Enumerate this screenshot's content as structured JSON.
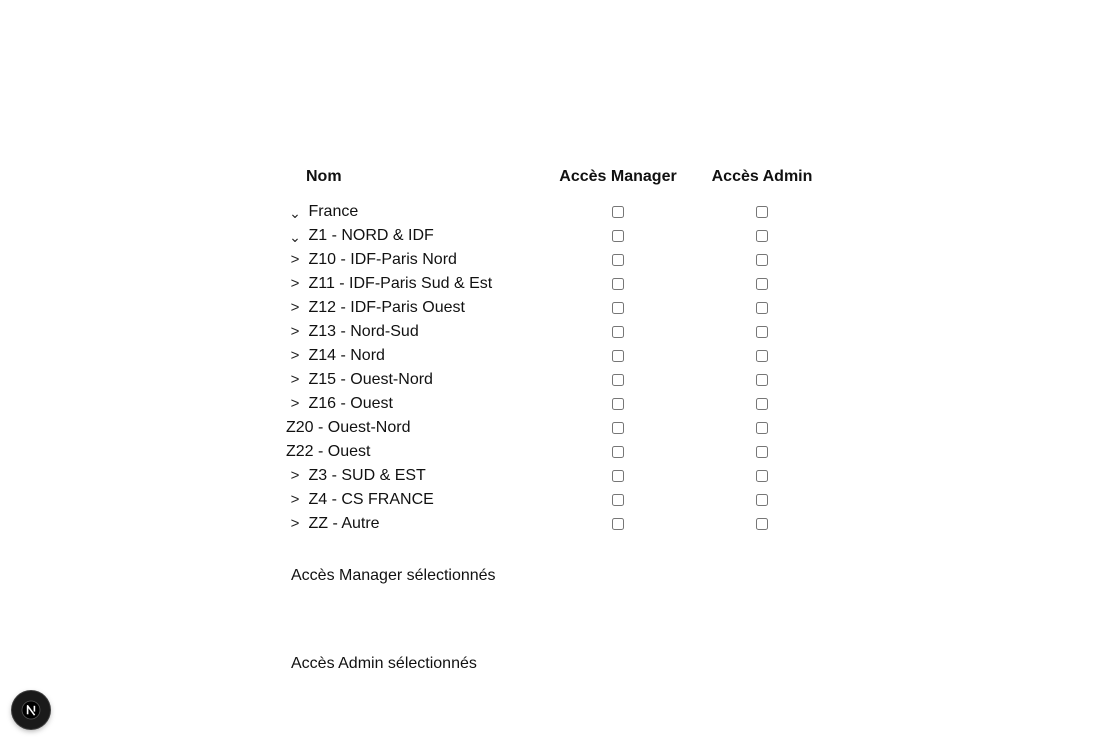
{
  "table": {
    "headers": {
      "name": "Nom",
      "manager": "Accès Manager",
      "admin": "Accès Admin"
    },
    "rows": [
      {
        "label": "France",
        "toggle": "⌄",
        "manager_checked": false,
        "admin_checked": false
      },
      {
        "label": "Z1 - NORD & IDF",
        "toggle": "⌄",
        "manager_checked": false,
        "admin_checked": false
      },
      {
        "label": "Z10 - IDF-Paris Nord",
        "toggle": ">",
        "manager_checked": false,
        "admin_checked": false
      },
      {
        "label": "Z11 - IDF-Paris Sud & Est",
        "toggle": ">",
        "manager_checked": false,
        "admin_checked": false
      },
      {
        "label": "Z12 - IDF-Paris Ouest",
        "toggle": ">",
        "manager_checked": false,
        "admin_checked": false
      },
      {
        "label": "Z13 - Nord-Sud",
        "toggle": ">",
        "manager_checked": false,
        "admin_checked": false
      },
      {
        "label": "Z14 - Nord",
        "toggle": ">",
        "manager_checked": false,
        "admin_checked": false
      },
      {
        "label": "Z15 - Ouest-Nord",
        "toggle": ">",
        "manager_checked": false,
        "admin_checked": false
      },
      {
        "label": "Z16 - Ouest",
        "toggle": ">",
        "manager_checked": false,
        "admin_checked": false
      },
      {
        "label": "Z20 - Ouest-Nord",
        "toggle": "",
        "manager_checked": false,
        "admin_checked": false
      },
      {
        "label": "Z22 - Ouest",
        "toggle": "",
        "manager_checked": false,
        "admin_checked": false
      },
      {
        "label": "Z3 - SUD & EST",
        "toggle": ">",
        "manager_checked": false,
        "admin_checked": false
      },
      {
        "label": "Z4 - CS FRANCE",
        "toggle": ">",
        "manager_checked": false,
        "admin_checked": false
      },
      {
        "label": "ZZ - Autre",
        "toggle": ">",
        "manager_checked": false,
        "admin_checked": false
      }
    ]
  },
  "selected": {
    "manager_label": "Accès Manager sélectionnés",
    "admin_label": "Accès Admin sélectionnés"
  },
  "badge": {
    "letter": "N",
    "icon": "nextjs-logo-icon"
  }
}
